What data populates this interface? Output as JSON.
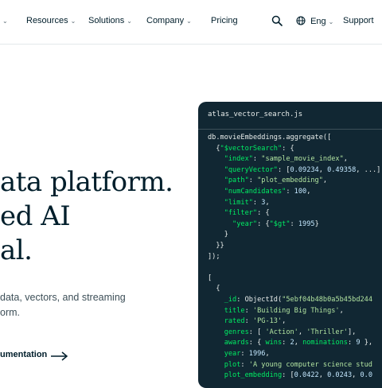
{
  "nav": {
    "items": [
      {
        "label": "Resources"
      },
      {
        "label": "Solutions"
      },
      {
        "label": "Company"
      },
      {
        "label": "Pricing"
      }
    ],
    "language": "Eng",
    "support": "Support"
  },
  "hero": {
    "line1": "ata platform.",
    "line2": "ed AI",
    "line3": "al.",
    "sub1": "data, vectors, and streaming",
    "sub2": "orm.",
    "cta": "umentation"
  },
  "code": {
    "filename": "atlas_vector_search.js",
    "lines": [
      "db.movieEmbeddings.aggregate([",
      "  {\"$vectorSearch\": {",
      "    \"index\": \"sample_movie_index\",",
      "    \"queryVector\": [0.09234, 0.49358, ...],",
      "    \"path\": \"plot_embedding\",",
      "    \"numCandidates\": 100,",
      "    \"limit\": 3,",
      "    \"filter\": {",
      "      \"year\": {\"$gt\": 1995}",
      "    }",
      "  }}",
      "]);",
      "",
      "[",
      "  {",
      "    _id: ObjectId(\"5ebf04b48b0a5b45bd244",
      "    title: 'Building Big Things',",
      "    rated: 'PG-13',",
      "    genres: [ 'Action', 'Thriller'],",
      "    awards: { wins: 2, nominations: 9 },",
      "    year: 1996,",
      "    plot: 'A young computer science stud",
      "    plot_embedding: [0.0422, 0.0243, 0.0"
    ]
  }
}
